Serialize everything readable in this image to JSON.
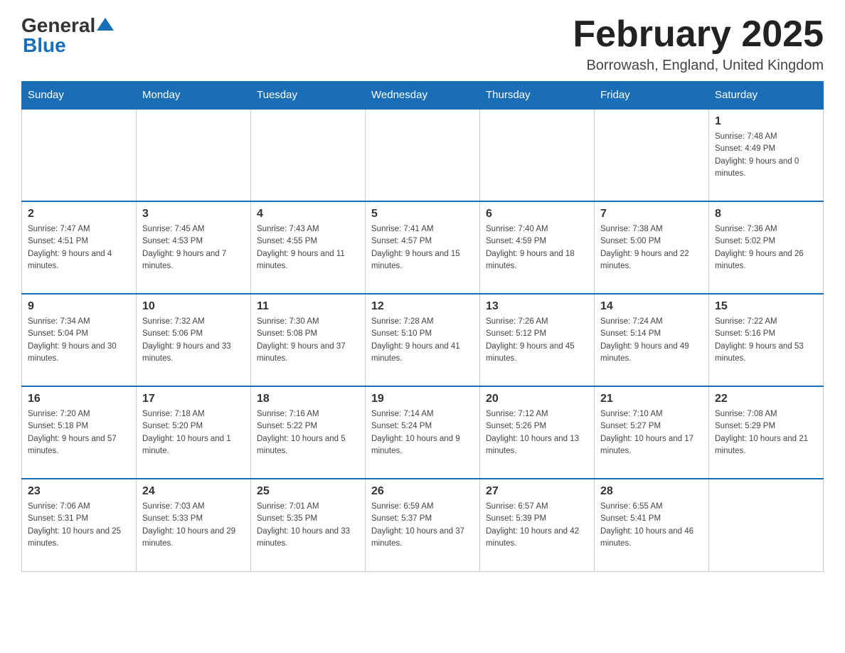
{
  "logo": {
    "general": "General",
    "blue": "Blue"
  },
  "header": {
    "title": "February 2025",
    "location": "Borrowash, England, United Kingdom"
  },
  "days_of_week": [
    "Sunday",
    "Monday",
    "Tuesday",
    "Wednesday",
    "Thursday",
    "Friday",
    "Saturday"
  ],
  "weeks": [
    [
      {
        "day": "",
        "info": ""
      },
      {
        "day": "",
        "info": ""
      },
      {
        "day": "",
        "info": ""
      },
      {
        "day": "",
        "info": ""
      },
      {
        "day": "",
        "info": ""
      },
      {
        "day": "",
        "info": ""
      },
      {
        "day": "1",
        "info": "Sunrise: 7:48 AM\nSunset: 4:49 PM\nDaylight: 9 hours and 0 minutes."
      }
    ],
    [
      {
        "day": "2",
        "info": "Sunrise: 7:47 AM\nSunset: 4:51 PM\nDaylight: 9 hours and 4 minutes."
      },
      {
        "day": "3",
        "info": "Sunrise: 7:45 AM\nSunset: 4:53 PM\nDaylight: 9 hours and 7 minutes."
      },
      {
        "day": "4",
        "info": "Sunrise: 7:43 AM\nSunset: 4:55 PM\nDaylight: 9 hours and 11 minutes."
      },
      {
        "day": "5",
        "info": "Sunrise: 7:41 AM\nSunset: 4:57 PM\nDaylight: 9 hours and 15 minutes."
      },
      {
        "day": "6",
        "info": "Sunrise: 7:40 AM\nSunset: 4:59 PM\nDaylight: 9 hours and 18 minutes."
      },
      {
        "day": "7",
        "info": "Sunrise: 7:38 AM\nSunset: 5:00 PM\nDaylight: 9 hours and 22 minutes."
      },
      {
        "day": "8",
        "info": "Sunrise: 7:36 AM\nSunset: 5:02 PM\nDaylight: 9 hours and 26 minutes."
      }
    ],
    [
      {
        "day": "9",
        "info": "Sunrise: 7:34 AM\nSunset: 5:04 PM\nDaylight: 9 hours and 30 minutes."
      },
      {
        "day": "10",
        "info": "Sunrise: 7:32 AM\nSunset: 5:06 PM\nDaylight: 9 hours and 33 minutes."
      },
      {
        "day": "11",
        "info": "Sunrise: 7:30 AM\nSunset: 5:08 PM\nDaylight: 9 hours and 37 minutes."
      },
      {
        "day": "12",
        "info": "Sunrise: 7:28 AM\nSunset: 5:10 PM\nDaylight: 9 hours and 41 minutes."
      },
      {
        "day": "13",
        "info": "Sunrise: 7:26 AM\nSunset: 5:12 PM\nDaylight: 9 hours and 45 minutes."
      },
      {
        "day": "14",
        "info": "Sunrise: 7:24 AM\nSunset: 5:14 PM\nDaylight: 9 hours and 49 minutes."
      },
      {
        "day": "15",
        "info": "Sunrise: 7:22 AM\nSunset: 5:16 PM\nDaylight: 9 hours and 53 minutes."
      }
    ],
    [
      {
        "day": "16",
        "info": "Sunrise: 7:20 AM\nSunset: 5:18 PM\nDaylight: 9 hours and 57 minutes."
      },
      {
        "day": "17",
        "info": "Sunrise: 7:18 AM\nSunset: 5:20 PM\nDaylight: 10 hours and 1 minute."
      },
      {
        "day": "18",
        "info": "Sunrise: 7:16 AM\nSunset: 5:22 PM\nDaylight: 10 hours and 5 minutes."
      },
      {
        "day": "19",
        "info": "Sunrise: 7:14 AM\nSunset: 5:24 PM\nDaylight: 10 hours and 9 minutes."
      },
      {
        "day": "20",
        "info": "Sunrise: 7:12 AM\nSunset: 5:26 PM\nDaylight: 10 hours and 13 minutes."
      },
      {
        "day": "21",
        "info": "Sunrise: 7:10 AM\nSunset: 5:27 PM\nDaylight: 10 hours and 17 minutes."
      },
      {
        "day": "22",
        "info": "Sunrise: 7:08 AM\nSunset: 5:29 PM\nDaylight: 10 hours and 21 minutes."
      }
    ],
    [
      {
        "day": "23",
        "info": "Sunrise: 7:06 AM\nSunset: 5:31 PM\nDaylight: 10 hours and 25 minutes."
      },
      {
        "day": "24",
        "info": "Sunrise: 7:03 AM\nSunset: 5:33 PM\nDaylight: 10 hours and 29 minutes."
      },
      {
        "day": "25",
        "info": "Sunrise: 7:01 AM\nSunset: 5:35 PM\nDaylight: 10 hours and 33 minutes."
      },
      {
        "day": "26",
        "info": "Sunrise: 6:59 AM\nSunset: 5:37 PM\nDaylight: 10 hours and 37 minutes."
      },
      {
        "day": "27",
        "info": "Sunrise: 6:57 AM\nSunset: 5:39 PM\nDaylight: 10 hours and 42 minutes."
      },
      {
        "day": "28",
        "info": "Sunrise: 6:55 AM\nSunset: 5:41 PM\nDaylight: 10 hours and 46 minutes."
      },
      {
        "day": "",
        "info": ""
      }
    ]
  ]
}
